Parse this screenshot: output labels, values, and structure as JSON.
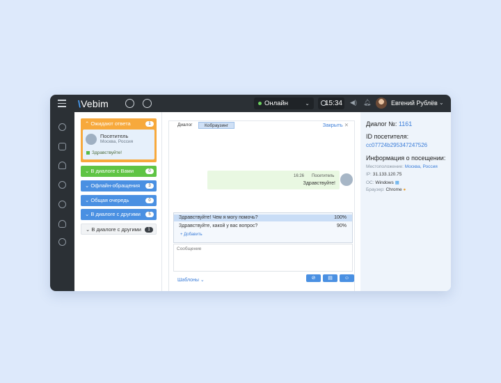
{
  "topbar": {
    "logo": "Vebim",
    "status": "Онлайн",
    "time": "15:34",
    "user_name": "Евгений Рублёв"
  },
  "queue": {
    "waiting": {
      "label": "Ожидают ответа",
      "count": "1"
    },
    "visitor": {
      "name": "Посетитель",
      "location": "Москва, Россия",
      "message": "Здравствуйте!"
    },
    "groups": [
      {
        "label": "В диалоге с Вами",
        "count": "0"
      },
      {
        "label": "Офлайн-обращения",
        "count": "3"
      },
      {
        "label": "Общая очередь",
        "count": "0"
      },
      {
        "label": "В диалоге с другими",
        "count": "5"
      },
      {
        "label": "В диалоге с другими",
        "count": "1"
      }
    ]
  },
  "chat": {
    "tabs": [
      "Диалог",
      "Кобраузинг"
    ],
    "close_label": "Закрыть",
    "message": {
      "time": "16:26",
      "author": "Посетитель",
      "text": "Здравствуйте!"
    },
    "suggestions": [
      {
        "text": "Здравствуйте! Чем я могу помочь?",
        "pct": "100%"
      },
      {
        "text": "Здравствуйте, какой у вас вопрос?",
        "pct": "90%"
      }
    ],
    "add_label": "+ Добавить",
    "input_placeholder": "Сообщение",
    "templates_label": "Шаблоны"
  },
  "info": {
    "dialog_label": "Диалог №:",
    "dialog_number": "1161",
    "visitor_id_label": "ID посетителя:",
    "visitor_id": "cc07724b295347247526",
    "visit_info_label": "Информация о посещении:",
    "location_label": "Местоположение:",
    "location": "Москва, Россия",
    "ip_label": "IP:",
    "ip": "31.133.120.75",
    "os_label": "ОС:",
    "os": "Windows",
    "browser_label": "Браузер:",
    "browser": "Chrome"
  }
}
